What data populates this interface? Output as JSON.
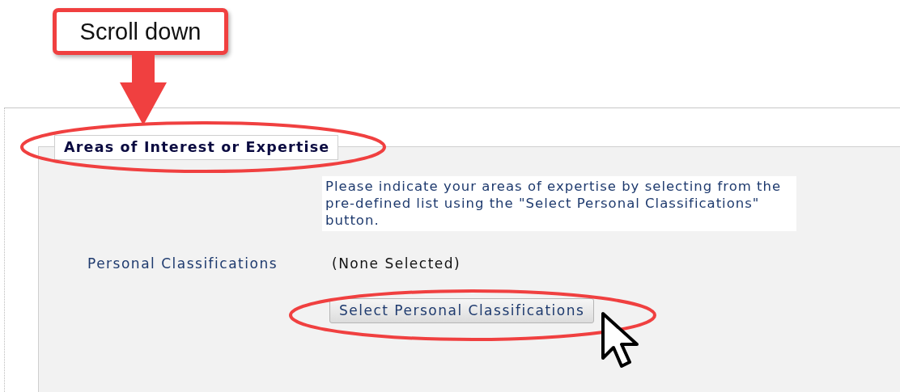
{
  "callout": {
    "text": "Scroll down"
  },
  "section": {
    "title": "Areas of Interest or Expertise",
    "instructions": "Please indicate your areas of expertise by selecting from the pre-defined list using the \"Select Personal Classifications\" button.",
    "fields": [
      {
        "label": "Personal Classifications",
        "value": "(None Selected)"
      }
    ],
    "button": "Select Personal Classifications"
  }
}
